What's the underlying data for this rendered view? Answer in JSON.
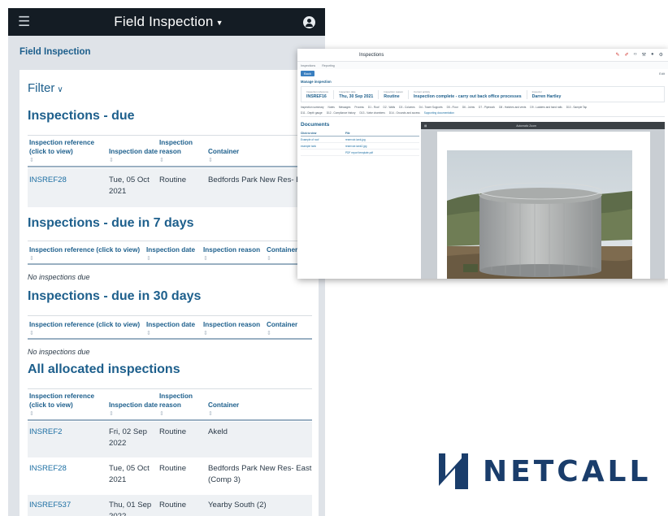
{
  "mobile": {
    "app_title": "Field Inspection",
    "breadcrumb": "Field Inspection",
    "filter_label": "Filter",
    "columns": {
      "reference_wide": "Inspection reference (click to view)",
      "reference_short": "Inspection reference (click to view)",
      "date": "Inspection date",
      "reason": "Inspection reason",
      "container": "Container",
      "sort_glyph": "⇕"
    },
    "sections": {
      "due": {
        "title": "Inspections - due",
        "rows": [
          {
            "ref": "INSREF28",
            "date": "Tue, 05 Oct 2021",
            "reason": "Routine",
            "container": "Bedfords Park New Res- East (Comp 3)"
          }
        ]
      },
      "due7": {
        "title": "Inspections - due in 7 days",
        "empty": "No inspections due"
      },
      "due30": {
        "title": "Inspections - due in 30 days",
        "empty": "No inspections due"
      },
      "allocated": {
        "title": "All allocated inspections",
        "rows": [
          {
            "ref": "INSREF2",
            "date": "Fri, 02 Sep 2022",
            "reason": "Routine",
            "container": "Akeld"
          },
          {
            "ref": "INSREF28",
            "date": "Tue, 05 Oct 2021",
            "reason": "Routine",
            "container": "Bedfords Park New Res- East (Comp 3)"
          },
          {
            "ref": "INSREF537",
            "date": "Thu, 01 Sep 2022",
            "reason": "Routine",
            "container": "Yearby South (2)"
          }
        ]
      }
    }
  },
  "desktop": {
    "app_title": "Inspections",
    "tabs": [
      "Inspections",
      "Reporting"
    ],
    "back_label": "Back",
    "toolbar_right": "Edit",
    "manage_title": "Manage inspection",
    "summary": [
      {
        "label": "Inspection reference",
        "value": "INSREF16"
      },
      {
        "label": "Inspection date",
        "value": "Thu, 30 Sep 2021"
      },
      {
        "label": "Inspection reason",
        "value": "Routine"
      },
      {
        "label": "Current activity",
        "value": "Inspection complete - carry out back office processes"
      },
      {
        "label": "Inspector",
        "value": "Darren Hartley"
      }
    ],
    "nav_row1": [
      "Inspection summary",
      "Notes",
      "Messages",
      "Process",
      "D1 - Roof",
      "D2 - Walls",
      "D3 - Columns",
      "D4 - Tower Supports",
      "D5 - Floor",
      "D6 - Joints",
      "D7 - Pipework",
      "D8 - Hatches and vents",
      "D9 - Ladders and hand rails",
      "D10 - Sample Tap"
    ],
    "nav_row2": [
      "D11 - Depth gauge",
      "D12 - Compliance history",
      "D13 - Valve chambers",
      "D14 - Grounds and access",
      "Supporting documentation"
    ],
    "documents_title": "Documents",
    "documents_header": [
      "Click to view",
      "File"
    ],
    "documents": [
      {
        "name": "Example of roof",
        "file": "reservoir-tank.jpg"
      },
      {
        "name": "example tank",
        "file": "reservoir-tank2.jpg"
      },
      {
        "name": "",
        "file": "PDF report template.pdf"
      }
    ],
    "viewer_zoom": "Automatic Zoom"
  },
  "brand": {
    "name": "NETCALL",
    "color": "#1a3d6b"
  },
  "colors": {
    "accent": "#1d5f8c",
    "topbar": "#141c24",
    "link": "#1d6fa3"
  }
}
